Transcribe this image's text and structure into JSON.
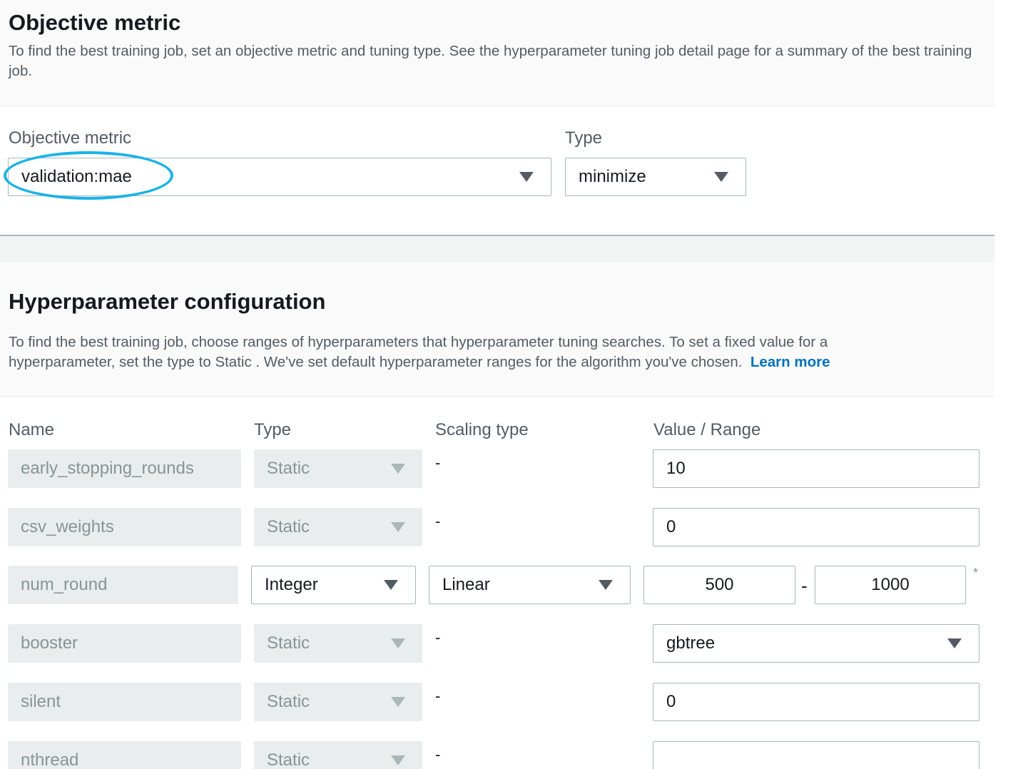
{
  "objective": {
    "title": "Objective metric",
    "description": "To find the best training job, set an objective metric and tuning type. See the hyperparameter tuning job detail page for a summary of the best training job.",
    "metric_label": "Objective metric",
    "metric_value": "validation:mae",
    "type_label": "Type",
    "type_value": "minimize"
  },
  "hyper": {
    "title": "Hyperparameter configuration",
    "description": "To find the best training job, choose ranges of hyperparameters that hyperparameter tuning searches. To set a fixed value for a hyperparameter, set the type to Static . We've set default hyperparameter ranges for the algorithm you've chosen.",
    "learn_more": "Learn more",
    "columns": {
      "name": "Name",
      "type": "Type",
      "scaling": "Scaling type",
      "value": "Value / Range"
    },
    "rows": [
      {
        "name": "early_stopping_rounds",
        "type": "Static",
        "scaling": "-",
        "value": "10"
      },
      {
        "name": "csv_weights",
        "type": "Static",
        "scaling": "-",
        "value": "0"
      },
      {
        "name": "num_round",
        "type": "Integer",
        "scaling": "Linear",
        "min": "500",
        "range_sep": "-",
        "max": "1000",
        "required_mark": "*"
      },
      {
        "name": "booster",
        "type": "Static",
        "scaling": "-",
        "value": "gbtree"
      },
      {
        "name": "silent",
        "type": "Static",
        "scaling": "-",
        "value": "0"
      },
      {
        "name": "nthread",
        "type": "Static",
        "scaling": "-",
        "value": ""
      }
    ]
  },
  "colors": {
    "accent_circle": "#1ab3e8",
    "link": "#0073bb"
  }
}
